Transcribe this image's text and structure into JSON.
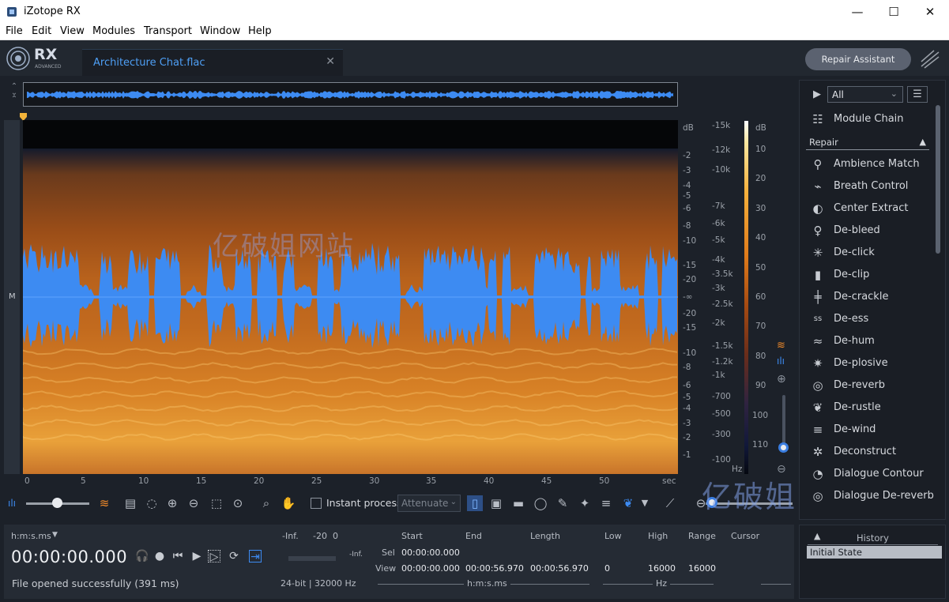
{
  "window": {
    "title": "iZotope RX",
    "min": "—",
    "max": "☐",
    "close": "✕"
  },
  "menu": [
    "File",
    "Edit",
    "View",
    "Modules",
    "Transport",
    "Window",
    "Help"
  ],
  "logo": {
    "text": "RX",
    "sub": "ADVANCED"
  },
  "file_tab": {
    "name": "Architecture Chat.flac",
    "close": "✕"
  },
  "repair_assistant": "Repair Assistant",
  "channel_label": "M",
  "db_scale": {
    "unit": "dB",
    "labels": [
      "-2",
      "-3",
      "-4",
      "-5",
      "-6",
      "-8",
      "-10",
      "-15",
      "-20",
      "-∞",
      "-20",
      "-15",
      "-10",
      "-8",
      "-6",
      "-5",
      "-4",
      "-3",
      "-2",
      "-1"
    ]
  },
  "hz_scale": {
    "unit": "Hz",
    "labels": [
      "-15k",
      "-12k",
      "-10k",
      "-7k",
      "-6k",
      "-5k",
      "-4k",
      "-3.5k",
      "-3k",
      "-2.5k",
      "-2k",
      "-1.5k",
      "-1.2k",
      "-1k",
      "-700",
      "-500",
      "-300",
      "-100"
    ]
  },
  "color_scale": {
    "unit": "dB",
    "labels": [
      "10",
      "20",
      "30",
      "40",
      "50",
      "60",
      "70",
      "80",
      "90",
      "100",
      "110"
    ]
  },
  "timeline": {
    "ticks": [
      "0",
      "5",
      "10",
      "15",
      "20",
      "25",
      "30",
      "35",
      "40",
      "45",
      "50"
    ],
    "unit": "sec"
  },
  "toolbar": {
    "instant_process": "Instant process",
    "attenuate": "Attenuate"
  },
  "info": {
    "time_format": "h:m:s.ms",
    "time": "00:00:00.000",
    "status": "File opened successfully (391 ms)",
    "meter_labels": [
      "-Inf.",
      "-20",
      "0"
    ],
    "meter_inf": "-Inf.",
    "format": "24-bit | 32000 Hz",
    "cols": {
      "start": "Start",
      "end": "End",
      "length": "Length",
      "low": "Low",
      "high": "High",
      "range": "Range",
      "cursor": "Cursor"
    },
    "sel_label": "Sel",
    "view_label": "View",
    "sel_start": "00:00:00.000",
    "view_start": "00:00:00.000",
    "view_end": "00:00:56.970",
    "view_length": "00:00:56.970",
    "view_low": "0",
    "view_high": "16000",
    "view_range": "16000",
    "time_unit": "h:m:s.ms",
    "freq_unit": "Hz"
  },
  "modules": {
    "filter": "All",
    "chain": "Module Chain",
    "section": "Repair",
    "items": [
      {
        "label": "Ambience Match",
        "icon": "ambience-match-icon"
      },
      {
        "label": "Breath Control",
        "icon": "breath-control-icon"
      },
      {
        "label": "Center Extract",
        "icon": "center-extract-icon"
      },
      {
        "label": "De-bleed",
        "icon": "de-bleed-icon"
      },
      {
        "label": "De-click",
        "icon": "de-click-icon"
      },
      {
        "label": "De-clip",
        "icon": "de-clip-icon"
      },
      {
        "label": "De-crackle",
        "icon": "de-crackle-icon"
      },
      {
        "label": "De-ess",
        "icon": "de-ess-icon"
      },
      {
        "label": "De-hum",
        "icon": "de-hum-icon"
      },
      {
        "label": "De-plosive",
        "icon": "de-plosive-icon"
      },
      {
        "label": "De-reverb",
        "icon": "de-reverb-icon"
      },
      {
        "label": "De-rustle",
        "icon": "de-rustle-icon"
      },
      {
        "label": "De-wind",
        "icon": "de-wind-icon"
      },
      {
        "label": "Deconstruct",
        "icon": "deconstruct-icon"
      },
      {
        "label": "Dialogue Contour",
        "icon": "dialogue-contour-icon"
      },
      {
        "label": "Dialogue De-reverb",
        "icon": "dialogue-de-reverb-icon"
      }
    ]
  },
  "history": {
    "title": "History",
    "items": [
      "Initial State"
    ]
  },
  "watermark": "亿破姐网站",
  "colors": {
    "accent": "#3a7de0",
    "waveform": "#3d8bf2",
    "tab_text": "#4e9ff5"
  }
}
